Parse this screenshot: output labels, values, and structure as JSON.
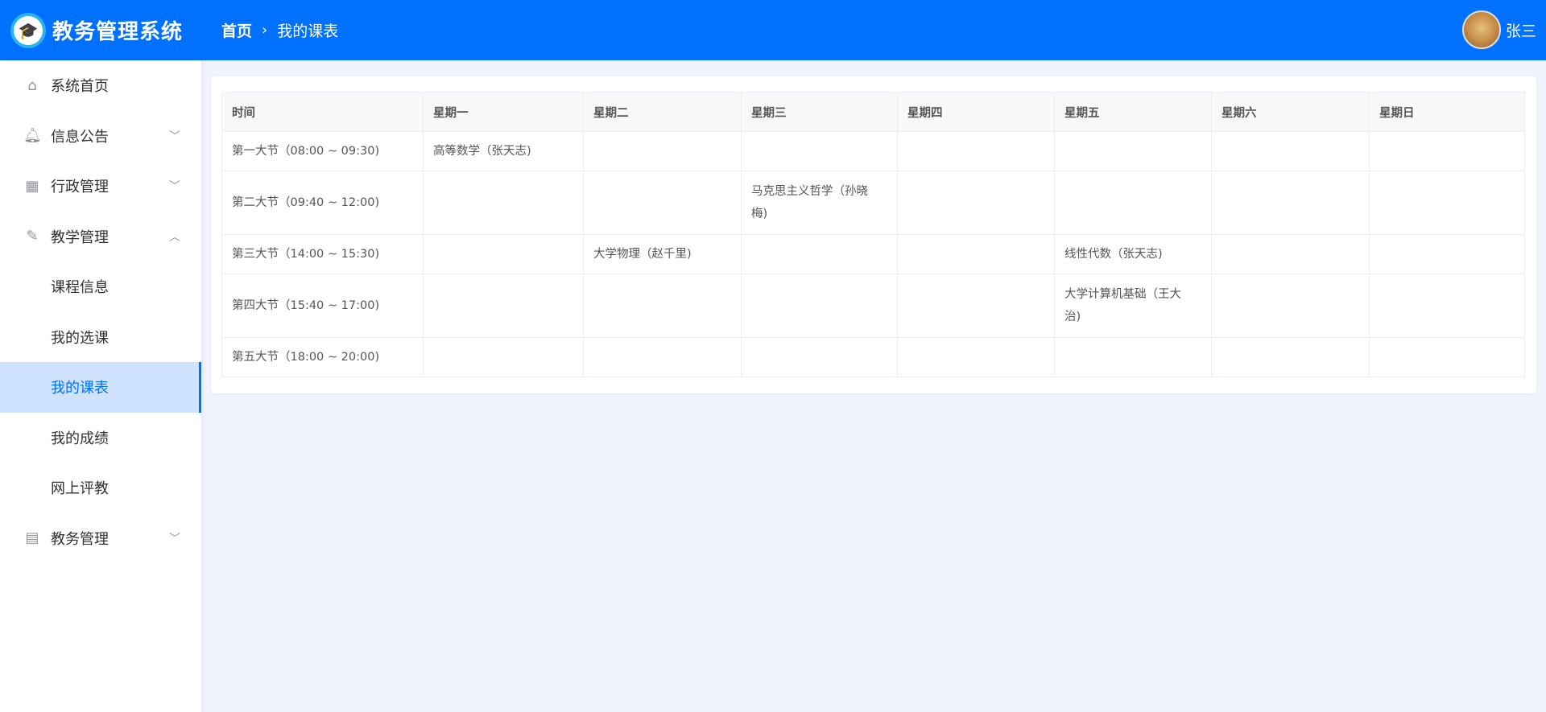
{
  "header": {
    "app_title": "教务管理系统",
    "breadcrumb": [
      "首页",
      "我的课表"
    ],
    "user_name": "张三"
  },
  "sidebar": {
    "items": [
      {
        "label": "系统首页",
        "icon": "home-icon"
      },
      {
        "label": "信息公告",
        "icon": "bell-icon",
        "expandable": true
      },
      {
        "label": "行政管理",
        "icon": "building-icon",
        "expandable": true
      },
      {
        "label": "教学管理",
        "icon": "edit-icon",
        "expanded": true,
        "children": [
          "课程信息",
          "我的选课",
          "我的课表",
          "我的成绩",
          "网上评教"
        ]
      },
      {
        "label": "教务管理",
        "icon": "calendar-icon",
        "expandable": true
      }
    ],
    "active": "我的课表"
  },
  "timetable": {
    "headers": [
      "时间",
      "星期一",
      "星期二",
      "星期三",
      "星期四",
      "星期五",
      "星期六",
      "星期日"
    ],
    "rows": [
      [
        "第一大节（08:00 ~ 09:30)",
        "高等数学（张天志)",
        "",
        "",
        "",
        "",
        "",
        ""
      ],
      [
        "第二大节（09:40 ~ 12:00)",
        "",
        "",
        "马克思主义哲学（孙晓梅)",
        "",
        "",
        "",
        ""
      ],
      [
        "第三大节（14:00 ~ 15:30)",
        "",
        "大学物理（赵千里)",
        "",
        "",
        "线性代数（张天志)",
        "",
        ""
      ],
      [
        "第四大节（15:40 ~ 17:00)",
        "",
        "",
        "",
        "",
        "大学计算机基础（王大治)",
        "",
        ""
      ],
      [
        "第五大节（18:00 ~ 20:00)",
        "",
        "",
        "",
        "",
        "",
        "",
        ""
      ]
    ]
  },
  "colors": {
    "primary": "#0070ff",
    "active_bg": "#cfe2ff",
    "page_bg": "#f0f4fd"
  }
}
